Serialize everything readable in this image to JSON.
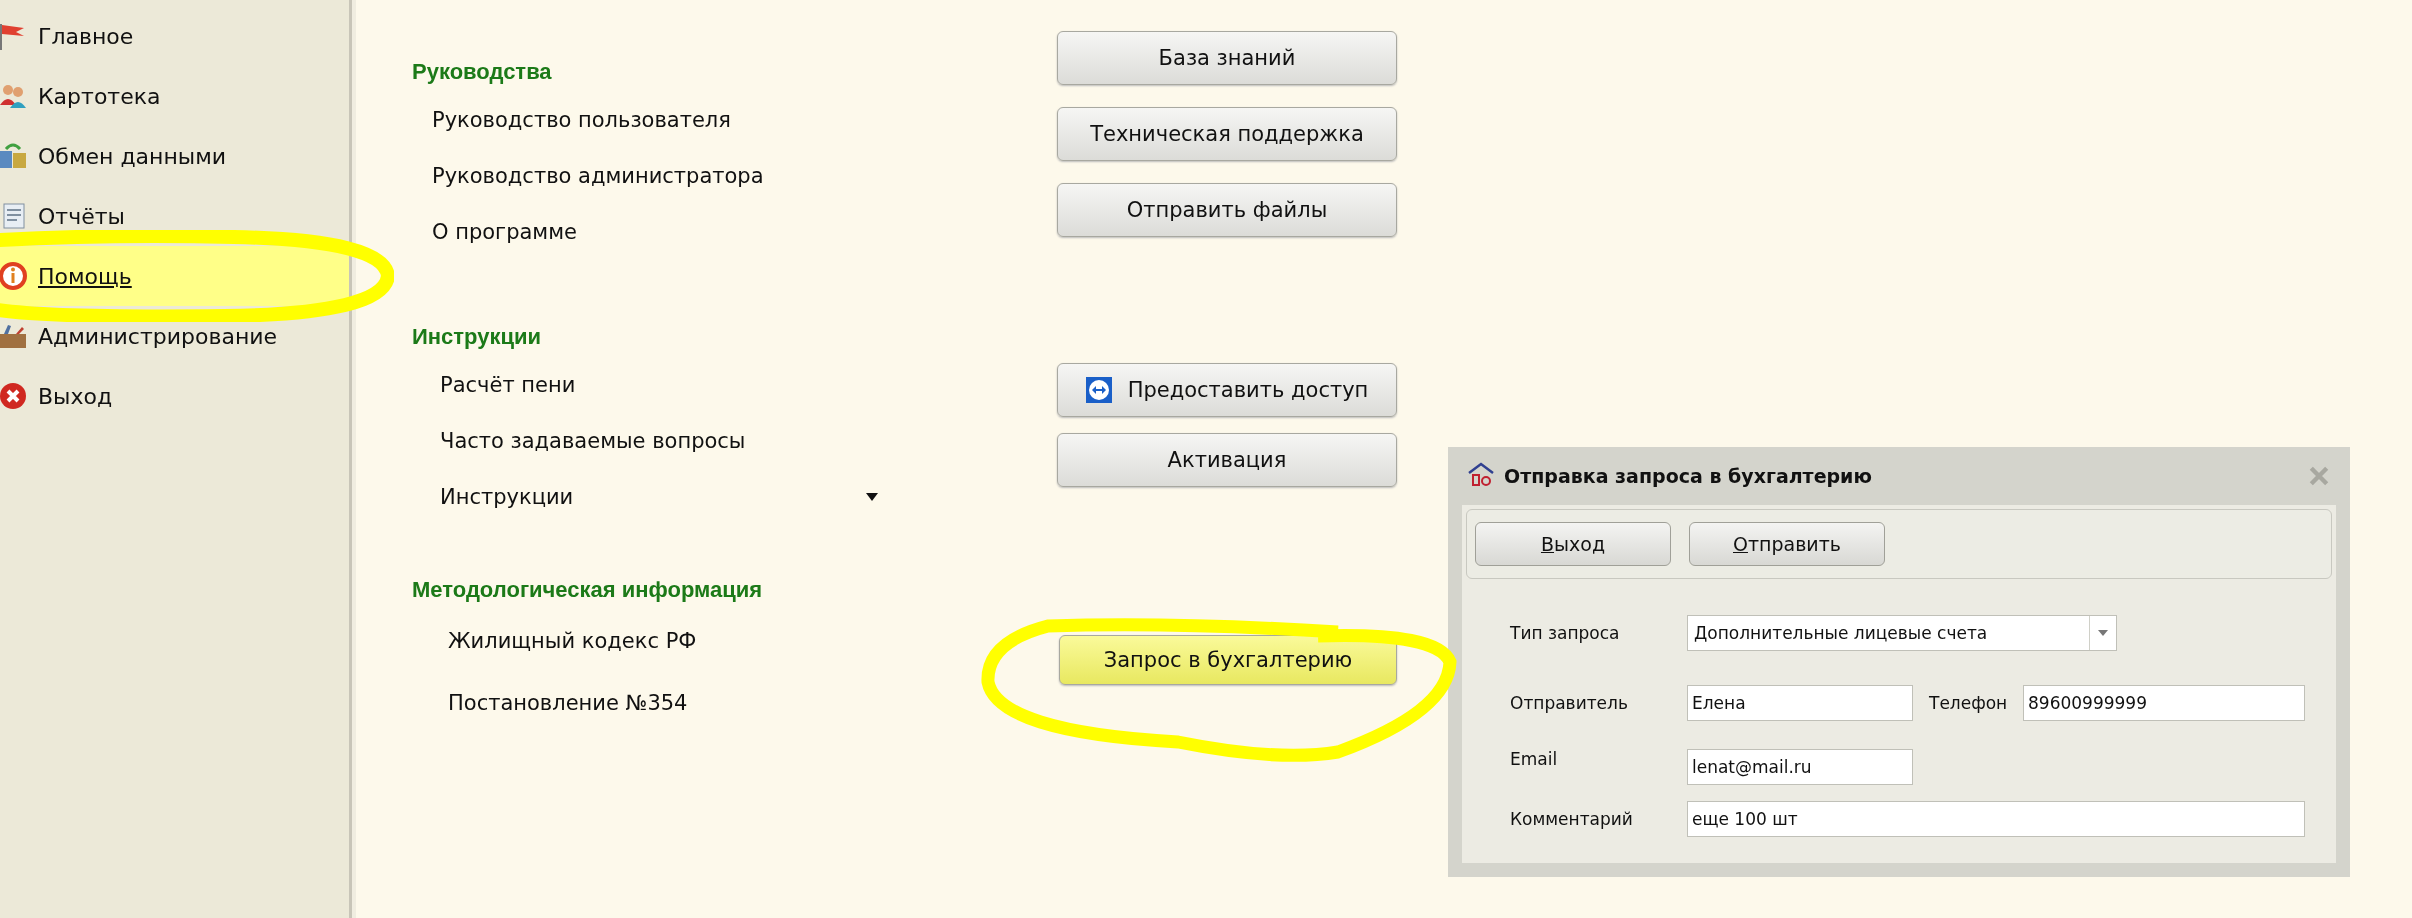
{
  "sidebar": {
    "items": [
      {
        "label": "Главное",
        "kind": "flag",
        "selected": false
      },
      {
        "label": "Картотека",
        "kind": "people",
        "selected": false
      },
      {
        "label": "Обмен данными",
        "kind": "database",
        "selected": false
      },
      {
        "label": "Отчёты",
        "kind": "report",
        "selected": false
      },
      {
        "label": "Помощь",
        "kind": "info",
        "selected": true
      },
      {
        "label": "Администрирование",
        "kind": "toolbox",
        "selected": false
      },
      {
        "label": "Выход",
        "kind": "exit",
        "selected": false
      }
    ]
  },
  "sections": [
    {
      "heading": "Руководства",
      "links": [
        {
          "label": "Руководство пользователя",
          "dropdown": false
        },
        {
          "label": "Руководство администратора",
          "dropdown": false
        },
        {
          "label": "О программе",
          "dropdown": false
        }
      ],
      "buttons": [
        {
          "label": "База знаний",
          "icon": false,
          "highlighted": false
        },
        {
          "label": "Техническая поддержка",
          "icon": false,
          "highlighted": false
        },
        {
          "label": "Отправить файлы",
          "icon": false,
          "highlighted": false
        }
      ]
    },
    {
      "heading": "Инструкции",
      "links": [
        {
          "label": "Расчёт пени",
          "dropdown": false
        },
        {
          "label": "Часто задаваемые вопросы",
          "dropdown": false
        },
        {
          "label": "Инструкции",
          "dropdown": true
        }
      ],
      "buttons": [
        {
          "label": "Предоставить доступ",
          "icon": true,
          "highlighted": false
        },
        {
          "label": "Активация",
          "icon": false,
          "highlighted": false
        }
      ]
    },
    {
      "heading": "Методологическая информация",
      "links": [
        {
          "label": "Жилищный кодекс РФ",
          "dropdown": false
        },
        {
          "label": "Постановление №354",
          "dropdown": false
        }
      ],
      "buttons": [
        {
          "label": "Запрос в бухгалтерию",
          "icon": false,
          "highlighted": true
        }
      ]
    }
  ],
  "dialog": {
    "title": "Отправка запроса в бухгалтерию",
    "buttons": [
      "Выход",
      "Отправить"
    ],
    "request_type": {
      "label": "Тип запроса",
      "value": "Дополнительные лицевые счета"
    },
    "sender": {
      "label": "Отправитель",
      "value": "Елена"
    },
    "phone": {
      "label": "Телефон",
      "value": "89600999999"
    },
    "email": {
      "label": "Email",
      "value": "lenat@mail.ru"
    },
    "comment": {
      "label": "Комментарий",
      "value": "еще 100 шт"
    }
  }
}
